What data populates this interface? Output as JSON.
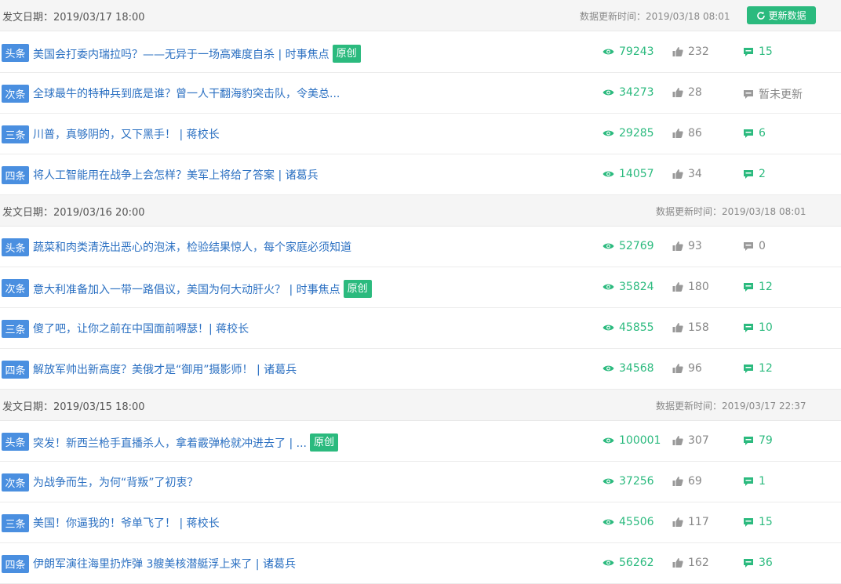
{
  "refresh_label": "更新数据",
  "groups": [
    {
      "date": "发文日期：2019/03/17 18:00",
      "updated": "数据更新时间：2019/03/18 08:01",
      "articles": [
        {
          "rank": "头条",
          "title": "美国会打委内瑞拉吗？——无异于一场高难度自杀 | 时事焦点",
          "badge": "原创",
          "views": "79243",
          "likes": "232",
          "comments": "15"
        },
        {
          "rank": "次条",
          "title": "全球最牛的特种兵到底是谁？曾一人干翻海豹突击队，令美总...",
          "badge": "",
          "views": "34273",
          "likes": "28",
          "comments": "暂未更新"
        },
        {
          "rank": "三条",
          "title": "川普，真够阴的，又下黑手！ | 蒋校长",
          "badge": "",
          "views": "29285",
          "likes": "86",
          "comments": "6"
        },
        {
          "rank": "四条",
          "title": "将人工智能用在战争上会怎样？美军上将给了答案 | 诸葛兵",
          "badge": "",
          "views": "14057",
          "likes": "34",
          "comments": "2"
        }
      ]
    },
    {
      "date": "发文日期：2019/03/16 20:00",
      "updated": "数据更新时间：2019/03/18 08:01",
      "articles": [
        {
          "rank": "头条",
          "title": "蔬菜和肉类清洗出恶心的泡沫，检验结果惊人，每个家庭必须知道",
          "badge": "",
          "views": "52769",
          "likes": "93",
          "comments": "0"
        },
        {
          "rank": "次条",
          "title": "意大利准备加入一带一路倡议，美国为何大动肝火？ | 时事焦点",
          "badge": "原创",
          "views": "35824",
          "likes": "180",
          "comments": "12"
        },
        {
          "rank": "三条",
          "title": "傻了吧，让你之前在中国面前嘚瑟！| 蒋校长",
          "badge": "",
          "views": "45855",
          "likes": "158",
          "comments": "10"
        },
        {
          "rank": "四条",
          "title": "解放军帅出新高度？美俄才是“御用”摄影师！ | 诸葛兵",
          "badge": "",
          "views": "34568",
          "likes": "96",
          "comments": "12"
        }
      ]
    },
    {
      "date": "发文日期：2019/03/15 18:00",
      "updated": "数据更新时间：2019/03/17 22:37",
      "articles": [
        {
          "rank": "头条",
          "title": "突发！新西兰枪手直播杀人，拿着霰弹枪就冲进去了 | ...",
          "badge": "原创",
          "views": "100001",
          "likes": "307",
          "comments": "79"
        },
        {
          "rank": "次条",
          "title": "为战争而生，为何“背叛”了初衷？",
          "badge": "",
          "views": "37256",
          "likes": "69",
          "comments": "1"
        },
        {
          "rank": "三条",
          "title": "美国！你逼我的！爷单飞了！ | 蒋校长",
          "badge": "",
          "views": "45506",
          "likes": "117",
          "comments": "15"
        },
        {
          "rank": "四条",
          "title": "伊朗军演往海里扔炸弹 3艘美核潜艇浮上来了 | 诸葛兵",
          "badge": "",
          "views": "56262",
          "likes": "162",
          "comments": "36"
        }
      ]
    }
  ]
}
